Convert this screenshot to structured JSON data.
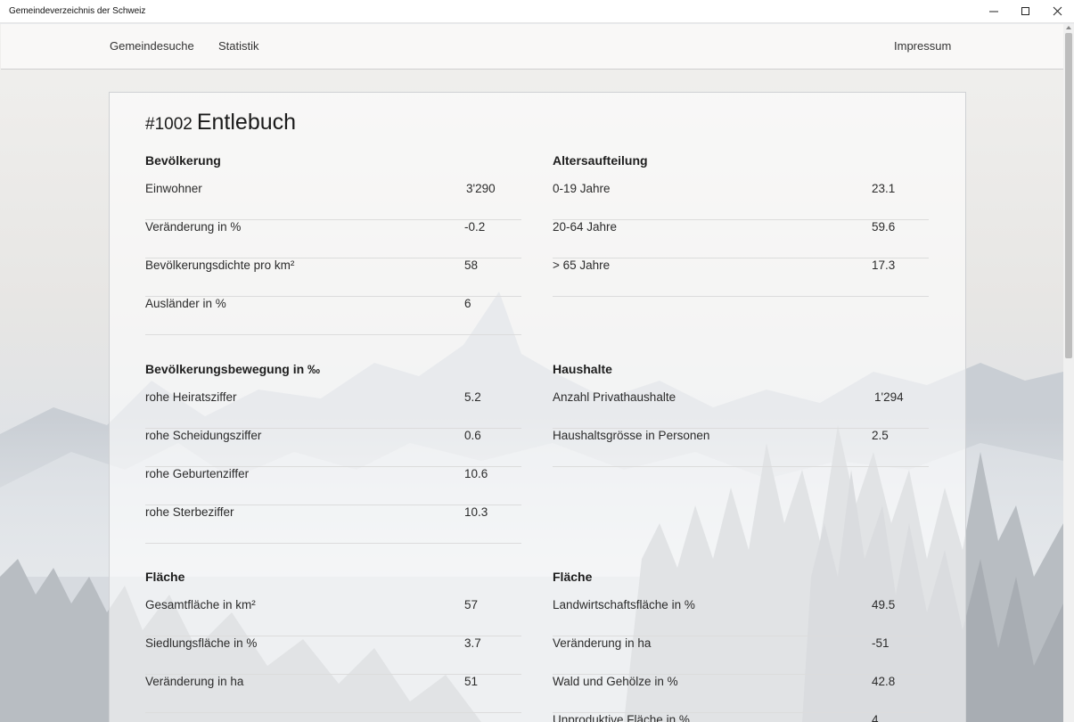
{
  "window": {
    "title": "Gemeindeverzeichnis der Schweiz"
  },
  "nav": {
    "items": [
      "Gemeindesuche",
      "Statistik"
    ],
    "impressum": "Impressum"
  },
  "municipality": {
    "number": "#1002",
    "name": "Entlebuch"
  },
  "sections": {
    "bevoelkerung": {
      "title": "Bevölkerung",
      "rows": [
        {
          "label": "Einwohner",
          "value": "3'290"
        },
        {
          "label": "Veränderung in %",
          "value": "-0.2"
        },
        {
          "label": "Bevölkerungsdichte pro km²",
          "value": "58"
        },
        {
          "label": "Ausländer in %",
          "value": "6"
        }
      ]
    },
    "alter": {
      "title": "Altersaufteilung",
      "rows": [
        {
          "label": "0-19 Jahre",
          "value": "23.1"
        },
        {
          "label": "20-64 Jahre",
          "value": "59.6"
        },
        {
          "label": "> 65 Jahre",
          "value": "17.3"
        }
      ]
    },
    "bewegung": {
      "title": "Bevölkerungsbewegung in ‰",
      "rows": [
        {
          "label": "rohe Heiratsziffer",
          "value": "5.2"
        },
        {
          "label": "rohe Scheidungsziffer",
          "value": "0.6"
        },
        {
          "label": "rohe Geburtenziffer",
          "value": "10.6"
        },
        {
          "label": "rohe Sterbeziffer",
          "value": "10.3"
        }
      ]
    },
    "haushalte": {
      "title": "Haushalte",
      "rows": [
        {
          "label": "Anzahl Privathaushalte",
          "value": "1'294"
        },
        {
          "label": "Haushaltsgrösse in Personen",
          "value": "2.5"
        }
      ]
    },
    "flaeche1": {
      "title": "Fläche",
      "rows": [
        {
          "label": "Gesamtfläche in km²",
          "value": "57"
        },
        {
          "label": "Siedlungsfläche in %",
          "value": "3.7"
        },
        {
          "label": "Veränderung in ha",
          "value": "51"
        }
      ]
    },
    "flaeche2": {
      "title": "Fläche",
      "rows": [
        {
          "label": "Landwirtschaftsfläche in %",
          "value": "49.5"
        },
        {
          "label": "Veränderung in ha",
          "value": "-51"
        },
        {
          "label": "Wald und Gehölze in %",
          "value": "42.8"
        },
        {
          "label": "Unproduktive Fläche in %",
          "value": "4"
        }
      ]
    }
  },
  "colors": {
    "accent_text": "#222222",
    "divider": "#dcdcdc"
  }
}
